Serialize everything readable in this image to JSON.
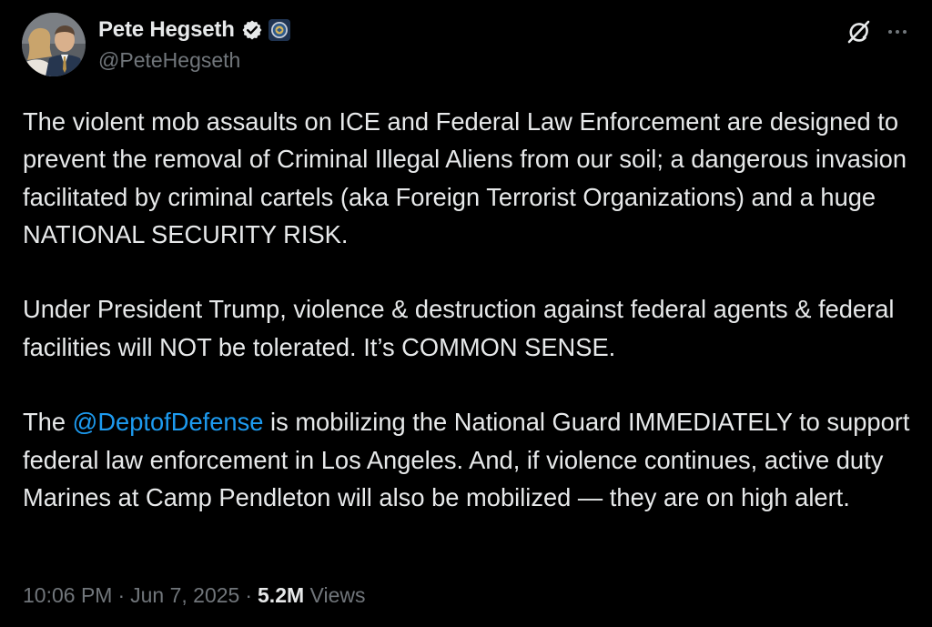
{
  "author": {
    "display_name": "Pete Hegseth",
    "handle": "@PeteHegseth",
    "avatar_icon": "profile-photo",
    "verified_icon": "verified-badge-icon",
    "affiliate_icon": "dept-of-defense-seal-icon"
  },
  "actions": {
    "grok_icon": "grok-icon",
    "more_icon": "more-icon"
  },
  "tweet": {
    "paragraphs": [
      {
        "text": "The violent mob assaults on ICE and Federal Law Enforcement are designed to prevent the removal of Criminal Illegal Aliens from our soil; a dangerous invasion facilitated by criminal cartels (aka Foreign Terrorist Organizations) and a huge NATIONAL SECURITY RISK."
      },
      {
        "text": "Under President Trump, violence & destruction against federal agents & federal facilities will NOT be tolerated. It’s COMMON SENSE."
      },
      {
        "before": "The ",
        "mention": "@DeptofDefense",
        "after": " is mobilizing the National Guard IMMEDIATELY to support federal law enforcement in Los Angeles. And, if violence continues, active duty Marines at Camp Pendleton will also be mobilized — they are on high alert."
      }
    ]
  },
  "meta": {
    "time": "10:06 PM",
    "separator": "·",
    "date": "Jun 7, 2025",
    "views_count": "5.2M",
    "views_label": "Views"
  },
  "colors": {
    "background": "#000000",
    "text": "#e7e9ea",
    "secondary": "#71767b",
    "link": "#1d9bf0",
    "verified": "#e7e9ea"
  }
}
